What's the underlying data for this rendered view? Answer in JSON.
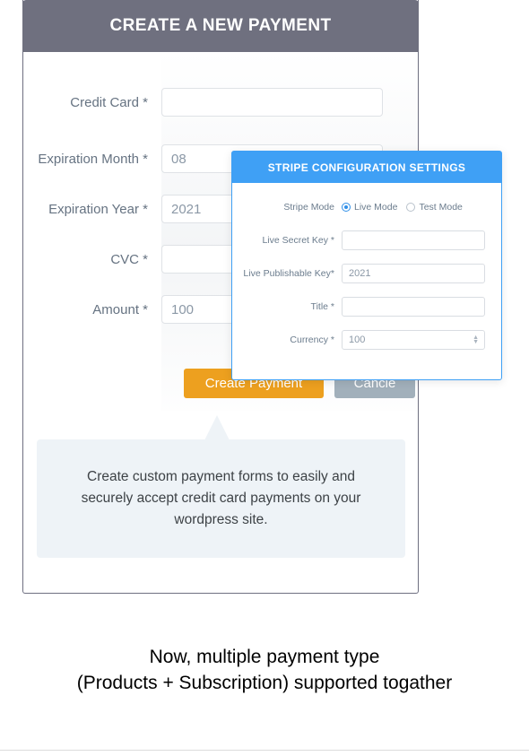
{
  "payment_form": {
    "header_title": "CREATE A NEW PAYMENT",
    "fields": [
      {
        "label": "Credit Card *",
        "value": "",
        "placeholder": ""
      },
      {
        "label": "Expiration Month *",
        "value": "",
        "placeholder": "08"
      },
      {
        "label": "Expiration Year *",
        "value": "",
        "placeholder": "2021"
      },
      {
        "label": "CVC *",
        "value": "",
        "placeholder": ""
      },
      {
        "label": "Amount *",
        "value": "",
        "placeholder": "100"
      }
    ],
    "buttons": {
      "submit_label": "Create Payment",
      "cancel_label": "Cancle"
    },
    "submit_color": "#eda01f",
    "cancel_color": "#a2b0bb",
    "header_color": "#6f707f"
  },
  "callout": {
    "text": "Create custom payment forms to easily and securely accept credit card payments on your wordpress site.",
    "background": "#eef3f7"
  },
  "stripe_modal": {
    "title": "STRIPE CONFIGURATION SETTINGS",
    "accent_color": "#3fa0f5",
    "mode_row": {
      "label": "Stripe Mode",
      "options": [
        {
          "label": "Live Mode",
          "selected": true
        },
        {
          "label": "Test Mode",
          "selected": false
        }
      ]
    },
    "fields": [
      {
        "label": "Live Secret Key  *",
        "value": "",
        "placeholder": ""
      },
      {
        "label": "Live Publishable Key*",
        "value": "",
        "placeholder": "2021"
      },
      {
        "label": "Title *",
        "value": "",
        "placeholder": ""
      }
    ],
    "currency": {
      "label": "Currency *",
      "value": "100",
      "stepper_up_icon": "chevron-up-icon",
      "stepper_down_icon": "chevron-down-icon"
    }
  },
  "headline": {
    "line1": "Now, multiple payment type",
    "line2": "(Products + Subscription) supported togather"
  }
}
